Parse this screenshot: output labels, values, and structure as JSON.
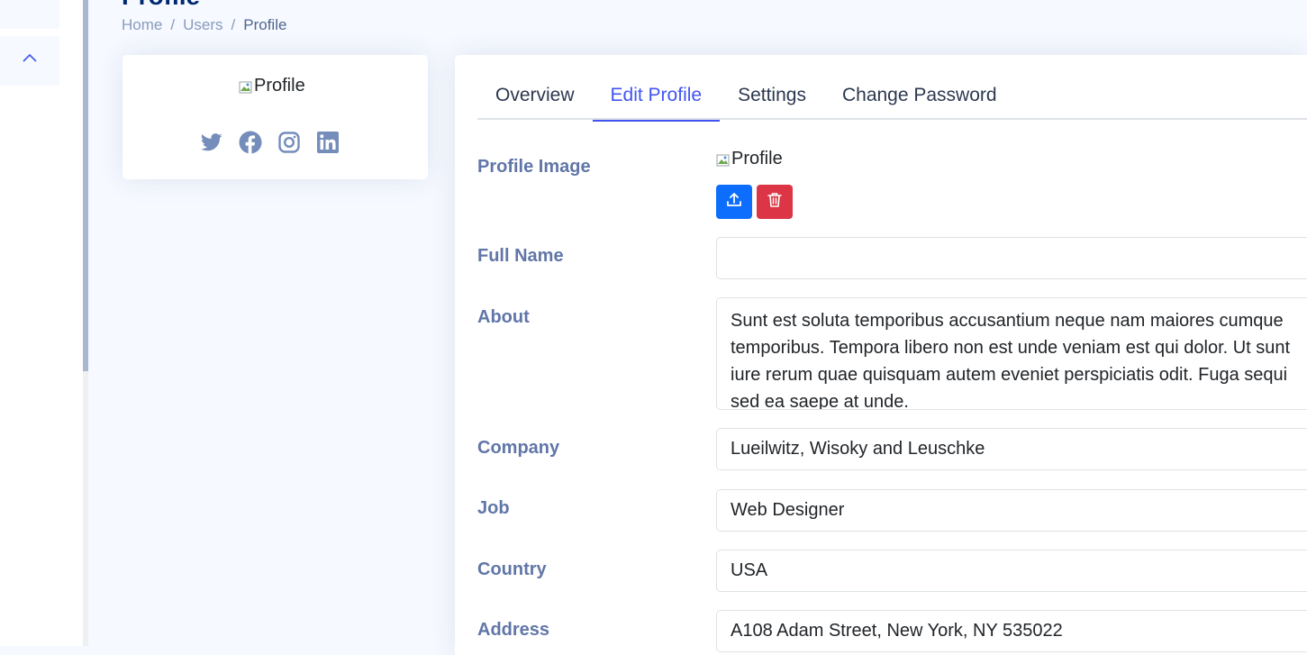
{
  "page": {
    "title": "Profile",
    "breadcrumb": [
      "Home",
      "Users",
      "Profile"
    ]
  },
  "left_card": {
    "profile_img_alt": "Profile",
    "social": [
      "twitter-icon",
      "facebook-icon",
      "instagram-icon",
      "linkedin-icon"
    ]
  },
  "tabs": [
    {
      "label": "Overview",
      "active": false
    },
    {
      "label": "Edit Profile",
      "active": true
    },
    {
      "label": "Settings",
      "active": false
    },
    {
      "label": "Change Password",
      "active": false
    }
  ],
  "form": {
    "profile_image": {
      "label": "Profile Image",
      "img_alt": "Profile"
    },
    "full_name": {
      "label": "Full Name",
      "value": ""
    },
    "about": {
      "label": "About",
      "value": "Sunt est soluta temporibus accusantium neque nam maiores cumque temporibus. Tempora libero non est unde veniam est qui dolor. Ut sunt iure rerum quae quisquam autem eveniet perspiciatis odit. Fuga sequi sed ea saepe at unde."
    },
    "company": {
      "label": "Company",
      "value": "Lueilwitz, Wisoky and Leuschke"
    },
    "job": {
      "label": "Job",
      "value": "Web Designer"
    },
    "country": {
      "label": "Country",
      "value": "USA"
    },
    "address": {
      "label": "Address",
      "value": "A108 Adam Street, New York, NY 535022"
    }
  },
  "colors": {
    "accent": "#4154f1",
    "title": "#012970",
    "upload_button": "#0d6efd",
    "delete_button": "#dc3545"
  }
}
